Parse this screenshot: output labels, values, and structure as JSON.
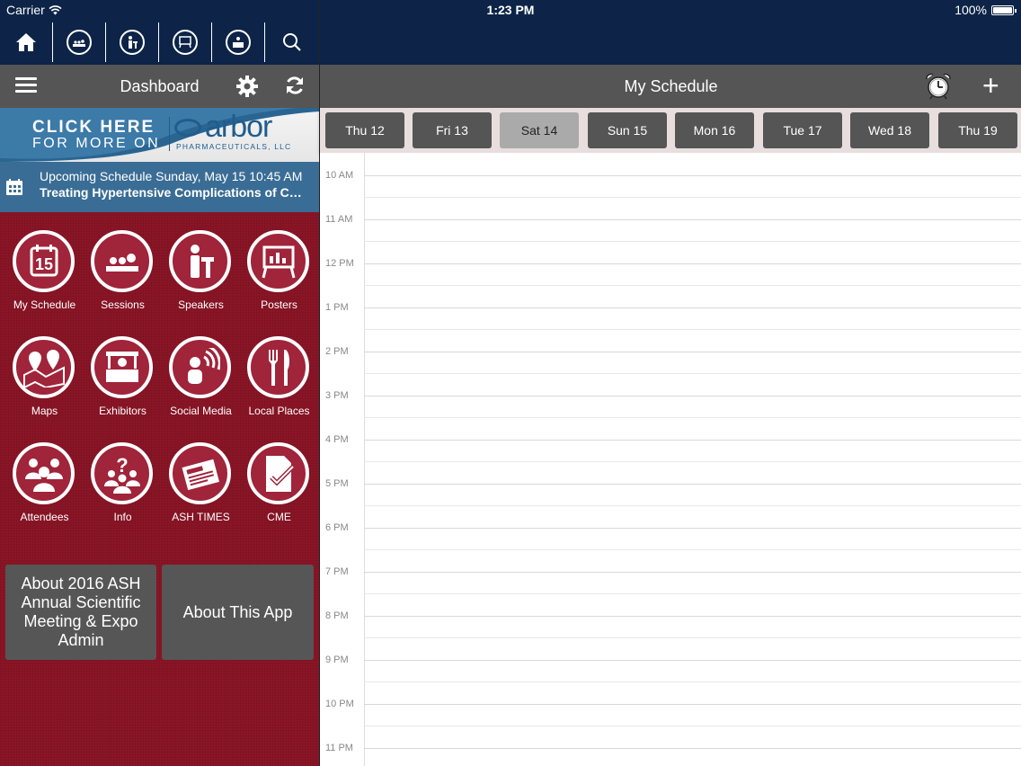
{
  "status": {
    "carrier": "Carrier",
    "time": "1:23 PM",
    "battery": "100%"
  },
  "nav_icons": [
    "home-icon",
    "sessions-icon",
    "speaker-icon",
    "poster-icon",
    "exhibitor-icon",
    "search-icon"
  ],
  "dashboard": {
    "title": "Dashboard"
  },
  "banner": {
    "click": "CLICK HERE",
    "more": "FOR MORE ON",
    "brand": "arbor",
    "brand_sub": "PHARMACEUTICALS, LLC"
  },
  "upcoming": {
    "line1": "Upcoming Schedule Sunday, May 15 10:45 AM",
    "line2": "Treating Hypertensive Complications of Chemotherapy"
  },
  "tiles": [
    {
      "label": "My Schedule",
      "icon": "calendar-icon"
    },
    {
      "label": "Sessions",
      "icon": "sessions-icon"
    },
    {
      "label": "Speakers",
      "icon": "speaker-icon"
    },
    {
      "label": "Posters",
      "icon": "poster-icon"
    },
    {
      "label": "Maps",
      "icon": "map-icon"
    },
    {
      "label": "Exhibitors",
      "icon": "exhibitor-icon"
    },
    {
      "label": "Social Media",
      "icon": "social-media-icon"
    },
    {
      "label": "Local Places",
      "icon": "fork-knife-icon"
    },
    {
      "label": "Attendees",
      "icon": "attendees-icon"
    },
    {
      "label": "Info",
      "icon": "info-icon"
    },
    {
      "label": "ASH TIMES",
      "icon": "newspaper-icon"
    },
    {
      "label": "CME",
      "icon": "cme-icon"
    }
  ],
  "calendar_number": "15",
  "about": {
    "left": "About 2016 ASH Annual Scientific Meeting & Expo Admin",
    "right": "About This App"
  },
  "schedule": {
    "title": "My Schedule"
  },
  "days": [
    "Thu 12",
    "Fri 13",
    "Sat 14",
    "Sun 15",
    "Mon 16",
    "Tue 17",
    "Wed 18",
    "Thu 19"
  ],
  "active_day": "Sat 14",
  "hours": [
    "10 AM",
    "11 AM",
    "12 PM",
    "1 PM",
    "2 PM",
    "3 PM",
    "4 PM",
    "5 PM",
    "6 PM",
    "7 PM",
    "8 PM",
    "9 PM",
    "10 PM",
    "11 PM"
  ],
  "colors": {
    "nav": "#0d2448",
    "toolbar": "#555555",
    "dashboard_red": "#8a1526",
    "upcoming_blue": "#3a6d95"
  }
}
